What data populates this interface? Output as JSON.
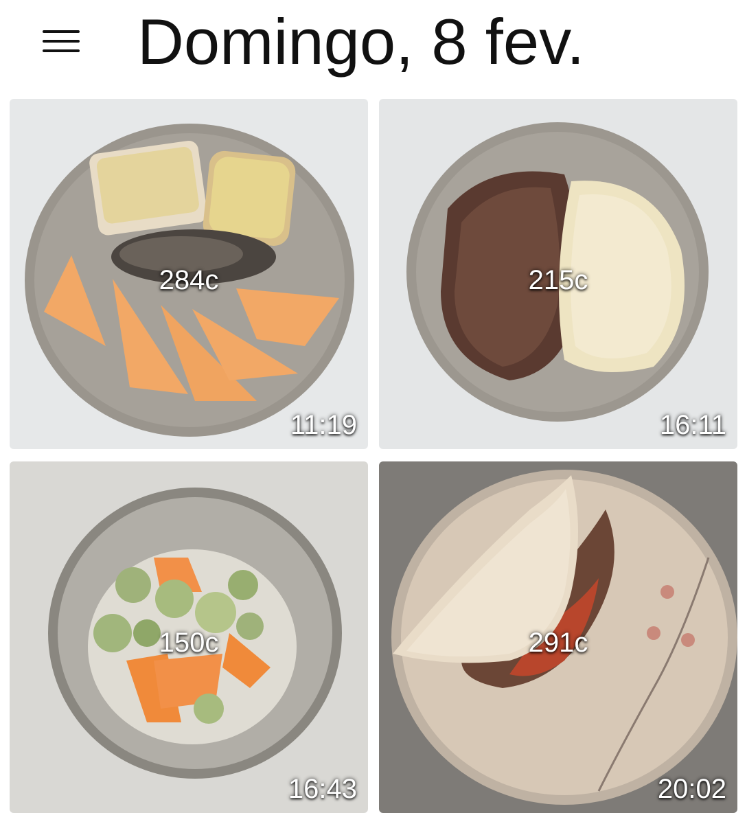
{
  "header": {
    "title": "Domingo, 8 fev.",
    "menu_icon": "hamburger-menu-icon"
  },
  "meals": [
    {
      "calories": "284c",
      "time": "11:19"
    },
    {
      "calories": "215c",
      "time": "16:11"
    },
    {
      "calories": "150c",
      "time": "16:43"
    },
    {
      "calories": "291c",
      "time": "20:02"
    }
  ]
}
